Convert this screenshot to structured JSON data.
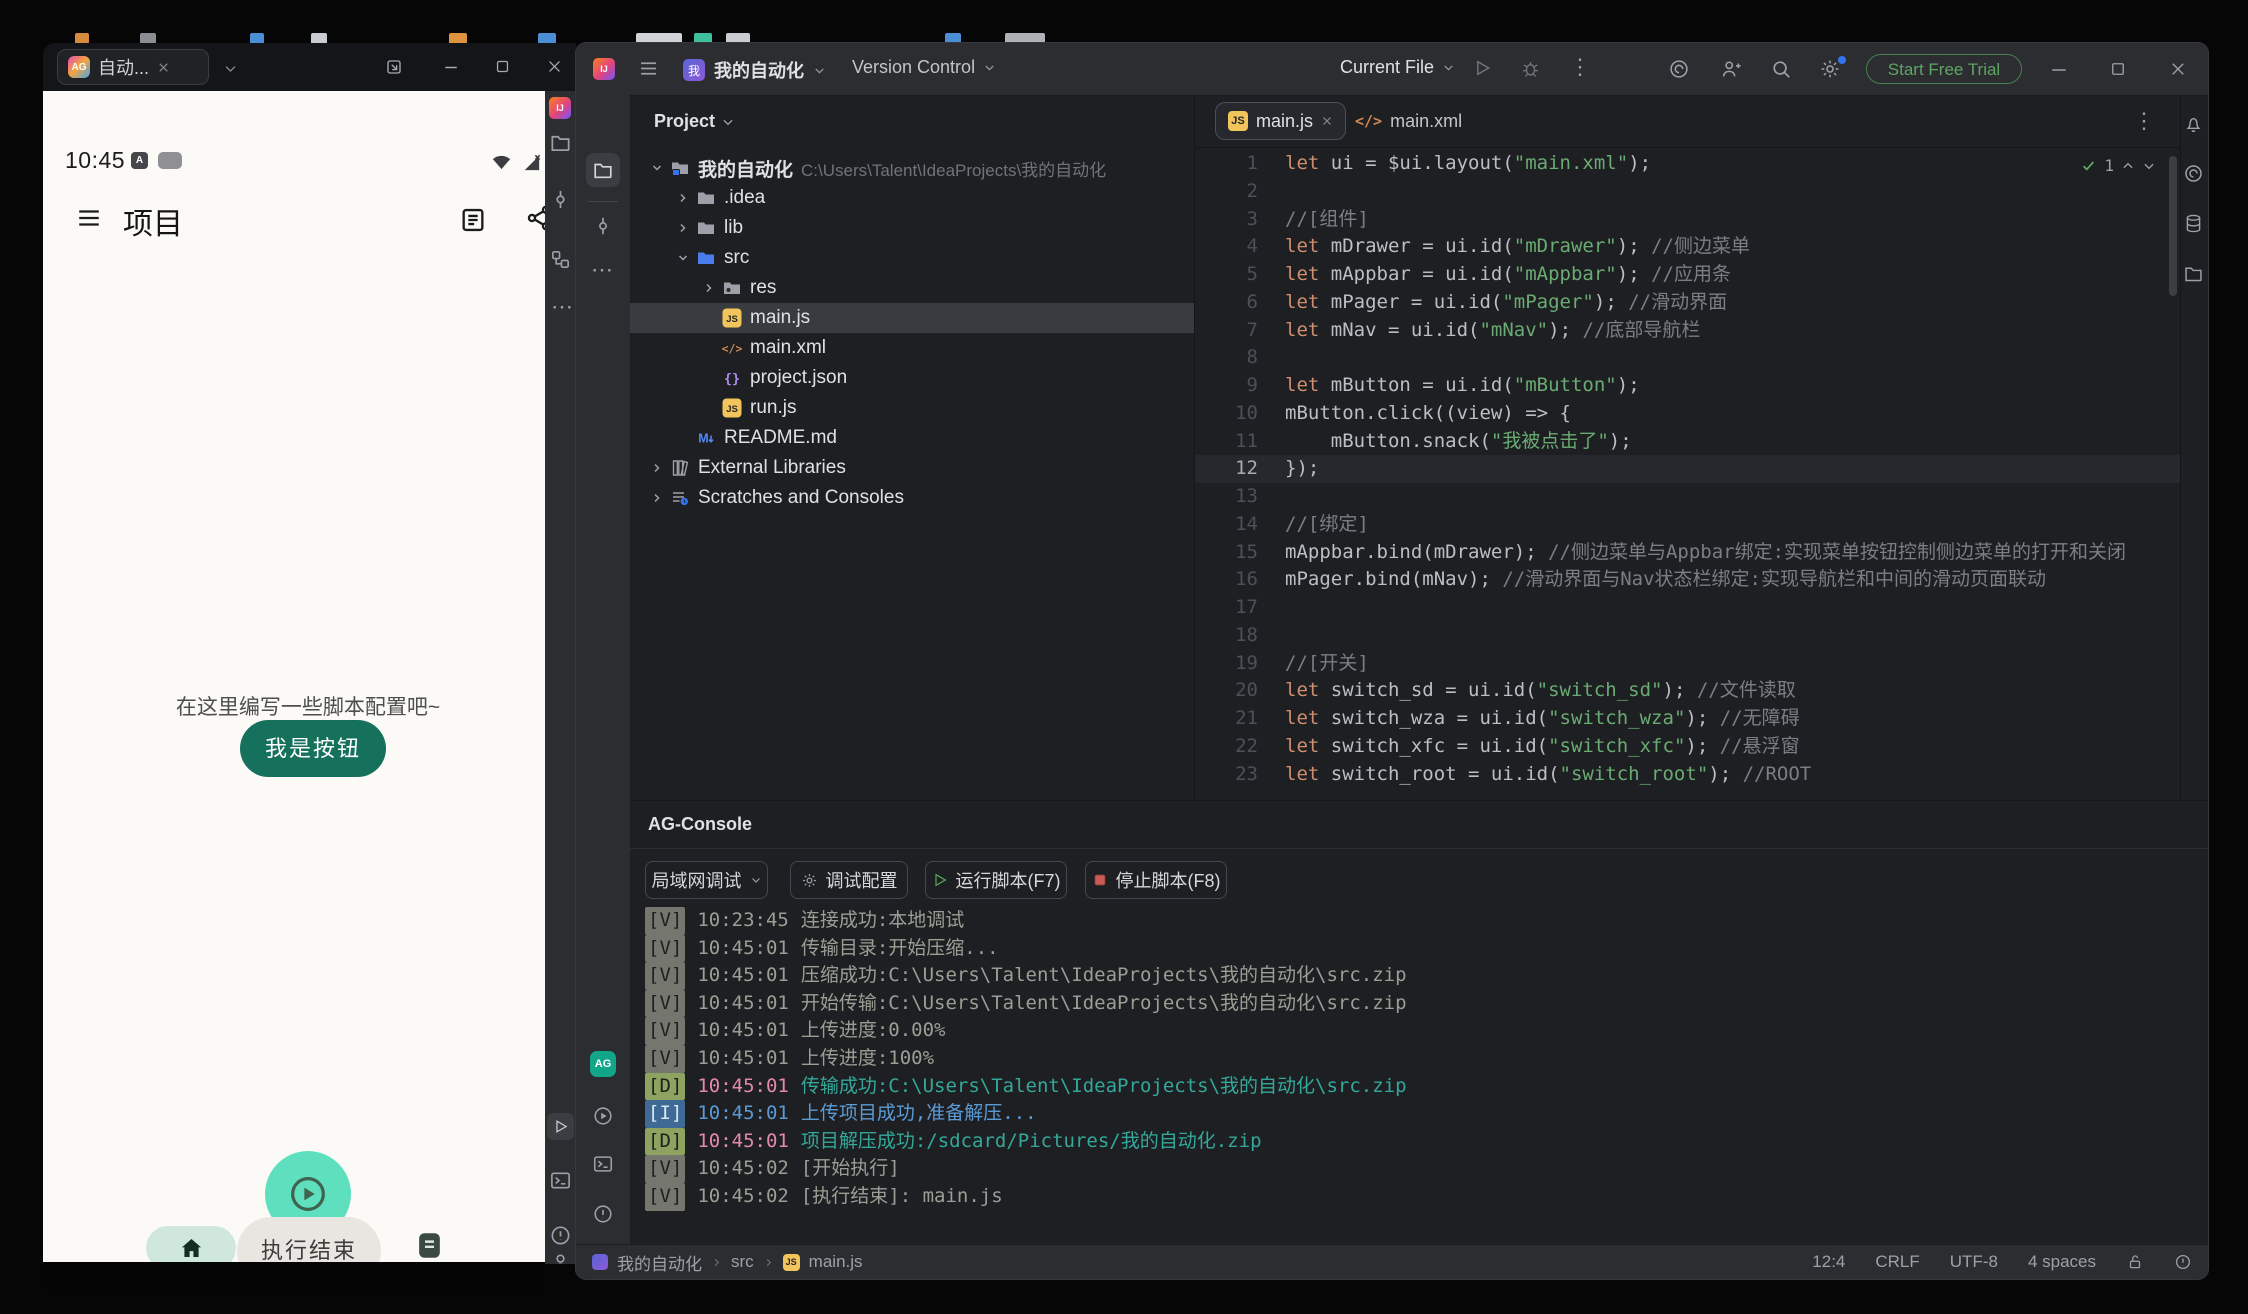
{
  "icons": {
    "kebab": "⋮",
    "ellipsis": "⋯"
  },
  "badges": {
    "ag": "AG",
    "ij": "IJ",
    "js": "JS",
    "md": "M",
    "a": "A",
    "project": "我"
  },
  "colors": {
    "accent": "#3574f0",
    "run_green": "#58a85c",
    "stop_red": "#cb5a52",
    "trial_green": "#5fa564",
    "js_badge": "#f2c55c",
    "fab_mint": "#5ee0bf",
    "phone_button_teal": "#15705c",
    "log_verbose": "#9b9e94",
    "log_debug_time": "#e289ac",
    "log_debug_msg": "#33a89a",
    "log_info": "#5b9bd5"
  },
  "phone": {
    "tab_title": "自动...",
    "time": "10:45",
    "app_title": "项目",
    "hint": "在这里编写一些脚本配置吧~",
    "button_label": "我是按钮",
    "toast": "执行结束",
    "nav_home": "主页",
    "nav_log": "日志"
  },
  "ide": {
    "title": {
      "project_name": "我的自动化",
      "vcs_label": "Version Control",
      "run_config": "Current File",
      "trial_label": "Start Free Trial"
    },
    "project": {
      "header": "Project",
      "tree": [
        {
          "id": "root",
          "label": "我的自动化",
          "path": "C:\\Users\\Talent\\IdeaProjects\\我的自动化",
          "type": "project",
          "depth": 0,
          "chevron": "open",
          "bold": true
        },
        {
          "id": "idea-folder",
          "label": ".idea",
          "type": "folder",
          "depth": 1,
          "chevron": "closed"
        },
        {
          "id": "lib-folder",
          "label": "lib",
          "type": "folder",
          "depth": 1,
          "chevron": "closed"
        },
        {
          "id": "src-folder",
          "label": "src",
          "type": "src",
          "depth": 1,
          "chevron": "open"
        },
        {
          "id": "res-folder",
          "label": "res",
          "type": "res",
          "depth": 2,
          "chevron": "closed"
        },
        {
          "id": "main-js",
          "label": "main.js",
          "type": "js",
          "depth": 2,
          "selected": true
        },
        {
          "id": "main-xml",
          "label": "main.xml",
          "type": "xml",
          "depth": 2
        },
        {
          "id": "project-json",
          "label": "project.json",
          "type": "json",
          "depth": 2
        },
        {
          "id": "run-js",
          "label": "run.js",
          "type": "js",
          "depth": 2
        },
        {
          "id": "readme-md",
          "label": "README.md",
          "type": "md",
          "depth": 1
        },
        {
          "id": "external-libraries",
          "label": "External Libraries",
          "type": "extlib",
          "depth": 0,
          "chevron": "closed"
        },
        {
          "id": "scratches",
          "label": "Scratches and Consoles",
          "type": "scratch",
          "depth": 0,
          "chevron": "closed"
        }
      ]
    },
    "editor": {
      "tabs": [
        {
          "label": "main.js"
        },
        {
          "label": "main.xml"
        }
      ],
      "inspection_count": "1",
      "lines": [
        {
          "n": 1,
          "t": [
            [
              "k",
              "let"
            ],
            [
              "p",
              " ui = $ui.layout("
            ],
            [
              "s",
              "\"main.xml\""
            ],
            [
              "p",
              ");"
            ]
          ]
        },
        {
          "n": 2,
          "t": []
        },
        {
          "n": 3,
          "t": [
            [
              "c",
              "//[组件]"
            ]
          ]
        },
        {
          "n": 4,
          "t": [
            [
              "k",
              "let"
            ],
            [
              "p",
              " mDrawer = ui.id("
            ],
            [
              "s",
              "\"mDrawer\""
            ],
            [
              "p",
              "); "
            ],
            [
              "c",
              "//侧边菜单"
            ]
          ]
        },
        {
          "n": 5,
          "t": [
            [
              "k",
              "let"
            ],
            [
              "p",
              " mAppbar = ui.id("
            ],
            [
              "s",
              "\"mAppbar\""
            ],
            [
              "p",
              "); "
            ],
            [
              "c",
              "//应用条"
            ]
          ]
        },
        {
          "n": 6,
          "t": [
            [
              "k",
              "let"
            ],
            [
              "p",
              " mPager = ui.id("
            ],
            [
              "s",
              "\"mPager\""
            ],
            [
              "p",
              "); "
            ],
            [
              "c",
              "//滑动界面"
            ]
          ]
        },
        {
          "n": 7,
          "t": [
            [
              "k",
              "let"
            ],
            [
              "p",
              " mNav = ui.id("
            ],
            [
              "s",
              "\"mNav\""
            ],
            [
              "p",
              "); "
            ],
            [
              "c",
              "//底部导航栏"
            ]
          ]
        },
        {
          "n": 8,
          "t": []
        },
        {
          "n": 9,
          "t": [
            [
              "k",
              "let"
            ],
            [
              "p",
              " mButton = ui.id("
            ],
            [
              "s",
              "\"mButton\""
            ],
            [
              "p",
              ");"
            ]
          ]
        },
        {
          "n": 10,
          "t": [
            [
              "p",
              "mButton.click((view) => {"
            ]
          ]
        },
        {
          "n": 11,
          "t": [
            [
              "p",
              "    mButton.snack("
            ],
            [
              "s",
              "\"我被点击了\""
            ],
            [
              "p",
              ");"
            ]
          ]
        },
        {
          "n": 12,
          "cur": true,
          "t": [
            [
              "p",
              "});"
            ]
          ]
        },
        {
          "n": 13,
          "t": []
        },
        {
          "n": 14,
          "t": [
            [
              "c",
              "//[绑定]"
            ]
          ]
        },
        {
          "n": 15,
          "t": [
            [
              "p",
              "mAppbar.bind(mDrawer); "
            ],
            [
              "c",
              "//侧边菜单与Appbar绑定:实现菜单按钮控制侧边菜单的打开和关闭"
            ]
          ]
        },
        {
          "n": 16,
          "t": [
            [
              "p",
              "mPager.bind(mNav); "
            ],
            [
              "c",
              "//滑动界面与Nav状态栏绑定:实现导航栏和中间的滑动页面联动"
            ]
          ]
        },
        {
          "n": 17,
          "t": []
        },
        {
          "n": 18,
          "t": []
        },
        {
          "n": 19,
          "t": [
            [
              "c",
              "//[开关]"
            ]
          ]
        },
        {
          "n": 20,
          "t": [
            [
              "k",
              "let"
            ],
            [
              "p",
              " switch_sd = ui.id("
            ],
            [
              "s",
              "\"switch_sd\""
            ],
            [
              "p",
              "); "
            ],
            [
              "c",
              "//文件读取"
            ]
          ]
        },
        {
          "n": 21,
          "t": [
            [
              "k",
              "let"
            ],
            [
              "p",
              " switch_wza = ui.id("
            ],
            [
              "s",
              "\"switch_wza\""
            ],
            [
              "p",
              "); "
            ],
            [
              "c",
              "//无障碍"
            ]
          ]
        },
        {
          "n": 22,
          "t": [
            [
              "k",
              "let"
            ],
            [
              "p",
              " switch_xfc = ui.id("
            ],
            [
              "s",
              "\"switch_xfc\""
            ],
            [
              "p",
              "); "
            ],
            [
              "c",
              "//悬浮窗"
            ]
          ]
        },
        {
          "n": 23,
          "t": [
            [
              "k",
              "let"
            ],
            [
              "p",
              " switch_root = ui.id("
            ],
            [
              "s",
              "\"switch_root\""
            ],
            [
              "p",
              "); "
            ],
            [
              "c",
              "//ROOT"
            ]
          ]
        }
      ]
    },
    "console": {
      "title": "AG-Console",
      "mode_dropdown": "局域网调试",
      "btn_config": "调试配置",
      "btn_run": "运行脚本(F7)",
      "btn_stop": "停止脚本(F8)",
      "logs": [
        {
          "level": "V",
          "time": "10:23:45",
          "msg": "连接成功:本地调试"
        },
        {
          "level": "V",
          "time": "10:45:01",
          "msg": "传输目录:开始压缩..."
        },
        {
          "level": "V",
          "time": "10:45:01",
          "msg": "压缩成功:C:\\Users\\Talent\\IdeaProjects\\我的自动化\\src.zip"
        },
        {
          "level": "V",
          "time": "10:45:01",
          "msg": "开始传输:C:\\Users\\Talent\\IdeaProjects\\我的自动化\\src.zip"
        },
        {
          "level": "V",
          "time": "10:45:01",
          "msg": "上传进度:0.00%"
        },
        {
          "level": "V",
          "time": "10:45:01",
          "msg": "上传进度:100%"
        },
        {
          "level": "D",
          "time": "10:45:01",
          "msg": "传输成功:C:\\Users\\Talent\\IdeaProjects\\我的自动化\\src.zip"
        },
        {
          "level": "I",
          "time": "10:45:01",
          "msg": "上传项目成功,准备解压..."
        },
        {
          "level": "D",
          "time": "10:45:01",
          "msg": "项目解压成功:/sdcard/Pictures/我的自动化.zip"
        },
        {
          "level": "V",
          "time": "10:45:02",
          "msg": "[开始执行]"
        },
        {
          "level": "V",
          "time": "10:45:02",
          "msg": "[执行结束]: main.js"
        }
      ]
    },
    "status": {
      "breadcrumbs": [
        "我的自动化",
        "src",
        "main.js"
      ],
      "pos": "12:4",
      "line_sep": "CRLF",
      "encoding": "UTF-8",
      "indent": "4 spaces"
    }
  }
}
